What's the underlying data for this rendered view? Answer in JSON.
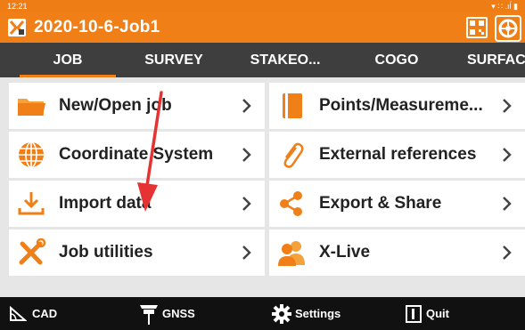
{
  "status": {
    "time": "12:21",
    "icons": "▾ ∷ .ıĺ ▮"
  },
  "header": {
    "job_title": "2020-10-6-Job1"
  },
  "tabs": [
    {
      "label": "JOB",
      "active": true
    },
    {
      "label": "SURVEY"
    },
    {
      "label": "STAKEO..."
    },
    {
      "label": "COGO"
    },
    {
      "label": "SURFAC"
    }
  ],
  "menu": {
    "left": [
      {
        "label": "New/Open job",
        "icon": "folder-icon"
      },
      {
        "label": "Coordinate System",
        "icon": "globe-icon"
      },
      {
        "label": "Import data",
        "icon": "import-icon"
      },
      {
        "label": "Job utilities",
        "icon": "tools-icon"
      }
    ],
    "right": [
      {
        "label": "Points/Measureme...",
        "icon": "points-book-icon"
      },
      {
        "label": "External references",
        "icon": "paperclip-icon"
      },
      {
        "label": "Export & Share",
        "icon": "share-icon"
      },
      {
        "label": "X-Live",
        "icon": "users-icon"
      }
    ]
  },
  "bottom_bar": {
    "cad": "CAD",
    "gnss": "GNSS",
    "settings": "Settings",
    "quit": "Quit"
  },
  "colors": {
    "accent": "#f07f17",
    "tab_bar": "#3e3e3e",
    "bottom_bar": "#111111",
    "annotation_arrow": "#e53333"
  }
}
